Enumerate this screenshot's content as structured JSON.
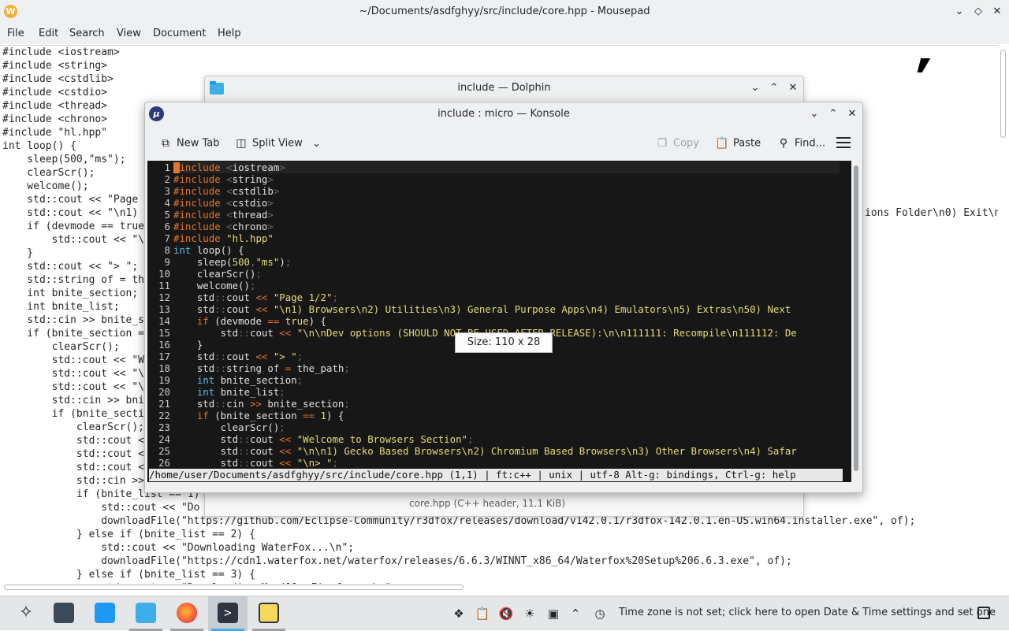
{
  "mousepad": {
    "title": "~/Documents/asdfghyy/src/include/core.hpp - Mousepad",
    "menu": [
      "File",
      "Edit",
      "Search",
      "View",
      "Document",
      "Help"
    ],
    "lines": [
      "#include <iostream>",
      "#include <string>",
      "#include <cstdlib>",
      "#include <cstdio>",
      "#include <thread>",
      "#include <chrono>",
      "#include \"hl.hpp\"",
      "int loop() {",
      "    sleep(500,\"ms\");",
      "    clearScr();",
      "    welcome();",
      "    std::cout << \"Page",
      "    std::cout << \"\\n1)",
      "    if (devmode == true",
      "        std::cout << \"\\",
      "    }",
      "    std::cout << \"> \";",
      "    std::string of = th",
      "    int bnite_section;",
      "    int bnite_list;",
      "    std::cin >> bnite_s",
      "    if (bnite_section =",
      "        clearScr();",
      "        std::cout << \"W",
      "        std::cout << \"\\",
      "        std::cout << \"\\",
      "        std::cin >> bni",
      "        if (bnite_secti",
      "            clearScr();",
      "            std::cout <",
      "            std::cout <",
      "            std::cout <",
      "            std::cin >>",
      "            if (bnite_list == 1)",
      "                std::cout << \"Do",
      "                downloadFile(\"https://github.com/Eclipse-Community/r3dfox/releases/download/v142.0.1/r3dfox-142.0.1.en-US.win64.installer.exe\", of);",
      "            } else if (bnite_list == 2) {",
      "                std::cout << \"Downloading WaterFox...\\n\";",
      "                downloadFile(\"https://cdn1.waterfox.net/waterfox/releases/6.6.3/WINNT_x86_64/Waterfox%20Setup%206.6.3.exe\", of);",
      "            } else if (bnite_list == 3) {",
      "                std::cout << \"Downloading Mozilla Firefox...\\n\";"
    ],
    "right_fragment": "ions Folder\\n0) Exit\\n\""
  },
  "dolphin": {
    "title": "include — Dolphin",
    "status": "core.hpp (C++ header, 11.1 KiB)"
  },
  "konsole": {
    "title": "include : micro — Konsole",
    "toolbar": {
      "new_tab": "New Tab",
      "split_view": "Split View",
      "copy": "Copy",
      "paste": "Paste",
      "find": "Find..."
    },
    "micro_lines": [
      {
        "n": "1",
        "html": "<span class='kw'>#include</span> <span class='dm'>&lt;</span>iostream<span class='dm'>&gt;</span>"
      },
      {
        "n": "2",
        "html": "<span class='kw'>#include</span> <span class='dm'>&lt;</span>string<span class='dm'>&gt;</span>"
      },
      {
        "n": "3",
        "html": "<span class='kw'>#include</span> <span class='dm'>&lt;</span>cstdlib<span class='dm'>&gt;</span>"
      },
      {
        "n": "4",
        "html": "<span class='kw'>#include</span> <span class='dm'>&lt;</span>cstdio<span class='dm'>&gt;</span>"
      },
      {
        "n": "5",
        "html": "<span class='kw'>#include</span> <span class='dm'>&lt;</span>thread<span class='dm'>&gt;</span>"
      },
      {
        "n": "6",
        "html": "<span class='kw'>#include</span> <span class='dm'>&lt;</span>chrono<span class='dm'>&gt;</span>"
      },
      {
        "n": "7",
        "html": "<span class='kw'>#include</span> <span class='st'>\"hl.hpp\"</span>"
      },
      {
        "n": "8",
        "html": "<span class='ty'>int</span> loop() {"
      },
      {
        "n": "9",
        "html": "    sleep(<span class='st'>500</span><span class='dm'>,</span><span class='st'>\"ms\"</span>)<span class='dm'>;</span>"
      },
      {
        "n": "10",
        "html": "    clearScr()<span class='dm'>;</span>"
      },
      {
        "n": "11",
        "html": "    welcome()<span class='dm'>;</span>"
      },
      {
        "n": "12",
        "html": "    std<span class='dm'>::</span>cout <span class='op'>&lt;&lt;</span> <span class='st'>\"Page 1/2\"</span><span class='dm'>;</span>"
      },
      {
        "n": "13",
        "html": "    std<span class='dm'>::</span>cout <span class='op'>&lt;&lt;</span> <span class='st'>\"\\n1) Browsers\\n2) Utilities\\n3) General Purpose Apps\\n4) Emulators\\n5) Extras\\n50) Next</span>"
      },
      {
        "n": "14",
        "html": "    <span class='kw'>if</span> (devmode <span class='op'>==</span> <span class='st'>true</span>) {"
      },
      {
        "n": "15",
        "html": "        std<span class='dm'>::</span>cout <span class='op'>&lt;&lt;</span> <span class='st'>\"\\n\\nDev options (SHOULD NOT BE USED AFTER RELEASE):\\n\\n111111: Recompile\\n111112: De</span>"
      },
      {
        "n": "16",
        "html": "    }"
      },
      {
        "n": "17",
        "html": "    std<span class='dm'>::</span>cout <span class='op'>&lt;&lt;</span> <span class='st'>\"&gt; \"</span><span class='dm'>;</span>"
      },
      {
        "n": "18",
        "html": "    std<span class='dm'>::</span>string of <span class='op'>=</span> the_path<span class='dm'>;</span>"
      },
      {
        "n": "19",
        "html": "    <span class='ty'>int</span> bnite_section<span class='dm'>;</span>"
      },
      {
        "n": "20",
        "html": "    <span class='ty'>int</span> bnite_list<span class='dm'>;</span>"
      },
      {
        "n": "21",
        "html": "    std<span class='dm'>::</span>cin <span class='op'>&gt;&gt;</span> bnite_section<span class='dm'>;</span>"
      },
      {
        "n": "22",
        "html": "    <span class='kw'>if</span> (bnite_section <span class='op'>==</span> <span class='st'>1</span>) {"
      },
      {
        "n": "23",
        "html": "        clearScr()<span class='dm'>;</span>"
      },
      {
        "n": "24",
        "html": "        std<span class='dm'>::</span>cout <span class='op'>&lt;&lt;</span> <span class='st'>\"Welcome to Browsers Section\"</span><span class='dm'>;</span>"
      },
      {
        "n": "25",
        "html": "        std<span class='dm'>::</span>cout <span class='op'>&lt;&lt;</span> <span class='st'>\"\\n\\n1) Gecko Based Browsers\\n2) Chromium Based Browsers\\n3) Other Browsers\\n4) Safar</span>"
      },
      {
        "n": "26",
        "html": "        std<span class='dm'>::</span>cout <span class='op'>&lt;&lt;</span> <span class='st'>\"\\n&gt; \"</span><span class='dm'>;</span>"
      }
    ],
    "statusline": "/home/user/Documents/asdfghyy/src/include/core.hpp (1,1) | ft:c++ | unix | utf-8 Alt-g: bindings, Ctrl-g: help",
    "size_tooltip": "Size: 110 x 28"
  },
  "taskbar": {
    "timezone_text": "Time zone is not set; click here to open Date & Time settings and set one",
    "tasks": [
      "application-launcher",
      "system-settings",
      "discover",
      "dolphin",
      "firefox",
      "konsole",
      "mousepad"
    ]
  },
  "colors": {
    "accent": "#3daee9",
    "terminal_bg": "#171717",
    "syntax_keyword": "#e3762b",
    "syntax_string": "#e6db74",
    "syntax_type": "#5fb5e8"
  }
}
